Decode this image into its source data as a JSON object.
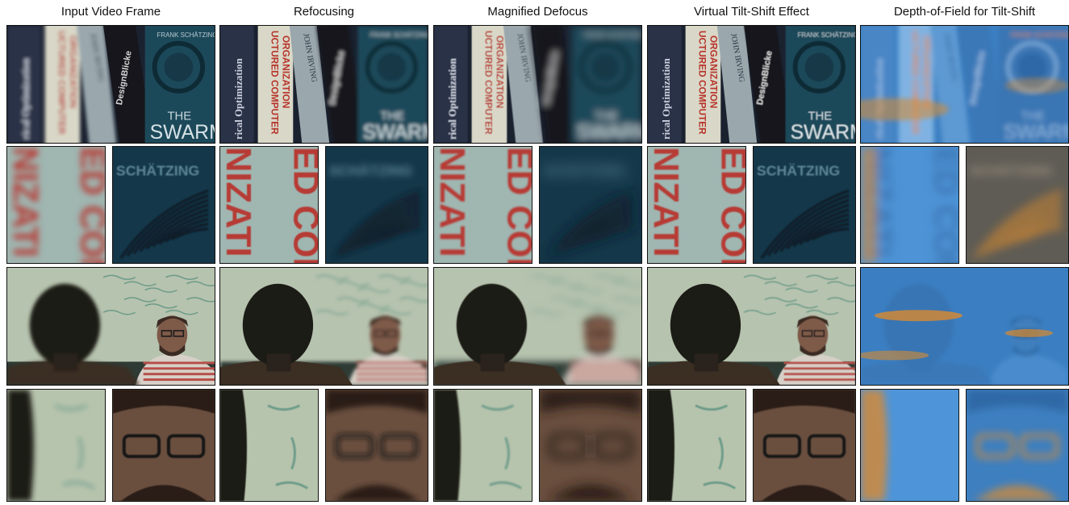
{
  "columns": [
    {
      "title": "Input Video Frame",
      "variant": "input"
    },
    {
      "title": "Refocusing",
      "variant": "refocus"
    },
    {
      "title": "Magnified Defocus",
      "variant": "magnified"
    },
    {
      "title": "Virtual Tilt-Shift Effect",
      "variant": "tiltshift"
    },
    {
      "title": "Depth-of-Field for Tilt-Shift",
      "variant": "dof"
    }
  ],
  "scenes": {
    "books": {
      "spines": [
        "rical Optimization",
        "UCTURED COMPUTER",
        "ORGANIZATION",
        "JOHN IRVING",
        "DesignBlicke"
      ],
      "cover_author": "FRANK SCHÄTZING",
      "cover_title_1": "THE",
      "cover_title_2": "SWARM",
      "crop_left_text": [
        "ED CON",
        "NIZATI"
      ],
      "crop_right_text": "SCHÄTZING"
    },
    "office": {
      "description_hidden": ""
    }
  },
  "colors": {
    "book_navy": "#2a3346",
    "book_cover": "#1f4a5a",
    "spine_red": "#b8342c",
    "spine_cream": "#d9d8c8",
    "whiteboard": "#b6c3ae",
    "dof_blue": "#3b7fc2",
    "dof_orange": "#d98a2e"
  }
}
